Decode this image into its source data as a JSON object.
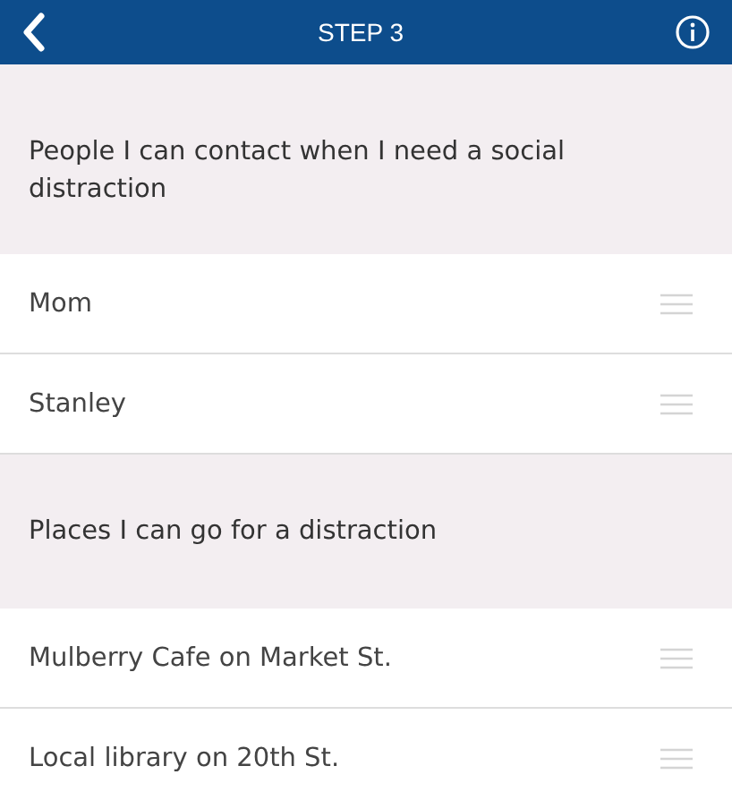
{
  "header": {
    "title": "STEP 3"
  },
  "sections": [
    {
      "title": "People I can contact when I need a social distraction",
      "items": [
        {
          "label": "Mom"
        },
        {
          "label": "Stanley"
        }
      ]
    },
    {
      "title": "Places I can go for a distraction",
      "items": [
        {
          "label": "Mulberry Cafe on Market St."
        },
        {
          "label": "Local library on 20th St."
        }
      ]
    }
  ]
}
